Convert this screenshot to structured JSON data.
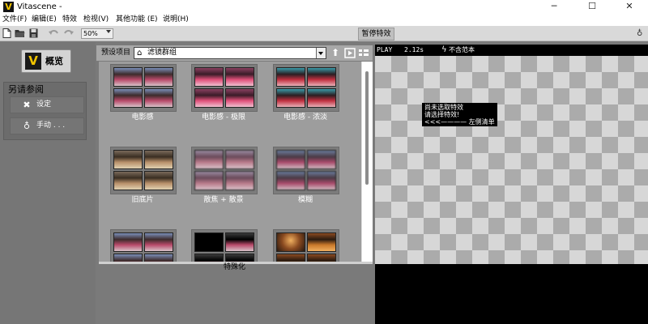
{
  "app": {
    "title": "Vitascene -",
    "logo_letter": "V"
  },
  "window_controls": {
    "minimize": "─",
    "maximize": "☐",
    "close": "✕"
  },
  "menu": [
    {
      "label": "文件(F)"
    },
    {
      "label": "编辑(E)"
    },
    {
      "label": "特效"
    },
    {
      "label": "检视(V)"
    },
    {
      "label": "其他功能 (E)"
    },
    {
      "label": "说明(H)"
    }
  ],
  "toolbar": {
    "zoom": "50%",
    "pause_tab": "暂停特效"
  },
  "left_panel": {
    "overview": {
      "logo": "V",
      "label": "概览"
    },
    "see_also": {
      "title": "另请参阅",
      "items": [
        {
          "icon": "✖",
          "label": "设定"
        },
        {
          "icon": "♁",
          "label": "手动 . . ."
        }
      ]
    }
  },
  "presets": {
    "label": "预设项目",
    "group": "滤镜群组",
    "category_label": "特殊化",
    "cards": [
      {
        "label": "电影感",
        "style": "cinema"
      },
      {
        "label": "电影感 - 极限",
        "style": "extreme"
      },
      {
        "label": "电影感 - 浓淡",
        "style": "shade"
      },
      {
        "label": "旧底片",
        "style": "old"
      },
      {
        "label": "散焦 + 散景",
        "style": "bokeh"
      },
      {
        "label": "模糊",
        "style": "blur"
      },
      {
        "label": "",
        "style": "cinema"
      },
      {
        "label": "",
        "style": "dark"
      },
      {
        "label": "",
        "style": "golden"
      }
    ]
  },
  "preview": {
    "status": "PLAY",
    "time": "2.12s",
    "no_scope_label": "不含范本",
    "notice": [
      "尚未选取特效",
      "请选择特效!",
      "<<<———— 左侧清单"
    ]
  },
  "colors": {
    "accent": "#f2c500",
    "preview_bg": "#000000",
    "checker_light": "#d7d7d7",
    "checker_dark": "#ababab"
  }
}
